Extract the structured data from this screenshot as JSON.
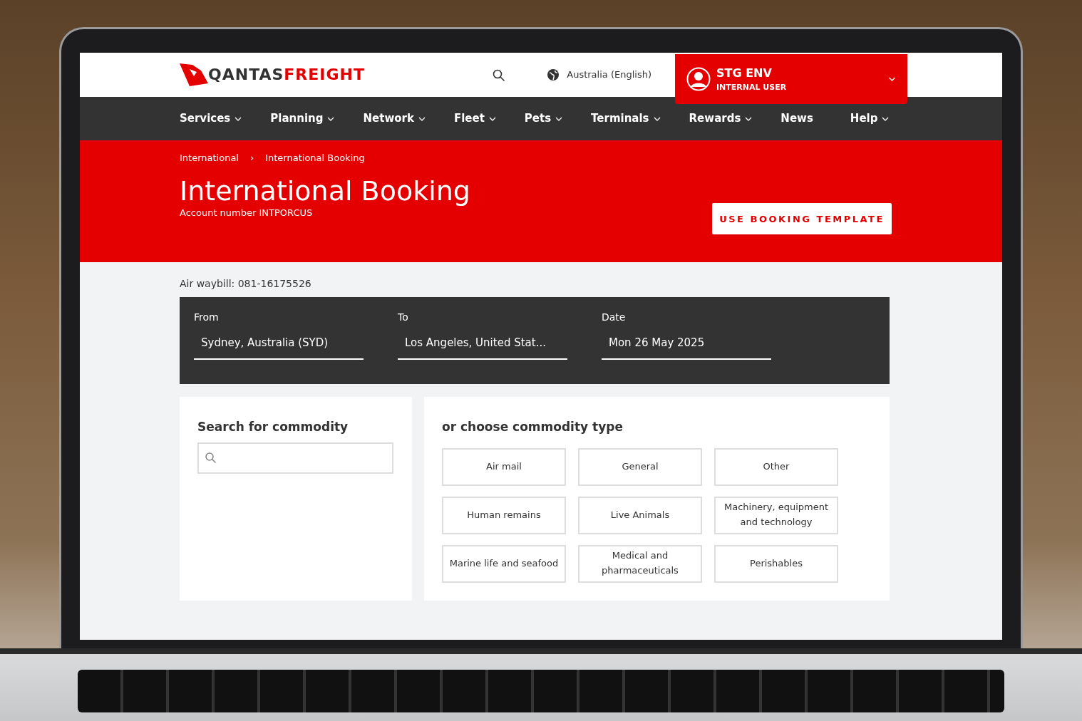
{
  "logo": {
    "primary": "QANTAS",
    "secondary": "FREIGHT"
  },
  "header": {
    "locale": "Australia (English)",
    "user": {
      "name": "STG ENV",
      "role": "INTERNAL USER"
    }
  },
  "nav": [
    {
      "label": "Services",
      "dropdown": true
    },
    {
      "label": "Planning",
      "dropdown": true
    },
    {
      "label": "Network",
      "dropdown": true
    },
    {
      "label": "Fleet",
      "dropdown": true
    },
    {
      "label": "Pets",
      "dropdown": true
    },
    {
      "label": "Terminals",
      "dropdown": true
    },
    {
      "label": "Rewards",
      "dropdown": true
    },
    {
      "label": "News",
      "dropdown": false
    },
    {
      "label": "Help",
      "dropdown": true
    }
  ],
  "breadcrumb": {
    "items": [
      "International",
      "International Booking"
    ],
    "separator": "›"
  },
  "hero": {
    "title": "International Booking",
    "account": "Account number INTPORCUS",
    "button": "USE BOOKING TEMPLATE"
  },
  "waybill": "Air waybill: 081-16175526",
  "route": [
    {
      "label": "From",
      "value": "Sydney, Australia (SYD)"
    },
    {
      "label": "To",
      "value": "Los Angeles, United Stat..."
    },
    {
      "label": "Date",
      "value": "Mon 26 May 2025"
    }
  ],
  "search": {
    "title": "Search for commodity"
  },
  "commodity": {
    "title": "or choose commodity type",
    "types": [
      "Air mail",
      "General",
      "Other",
      "Human remains",
      "Live Animals",
      "Machinery, equipment and technology",
      "Marine life and seafood",
      "Medical and pharmaceuticals",
      "Perishables"
    ]
  }
}
